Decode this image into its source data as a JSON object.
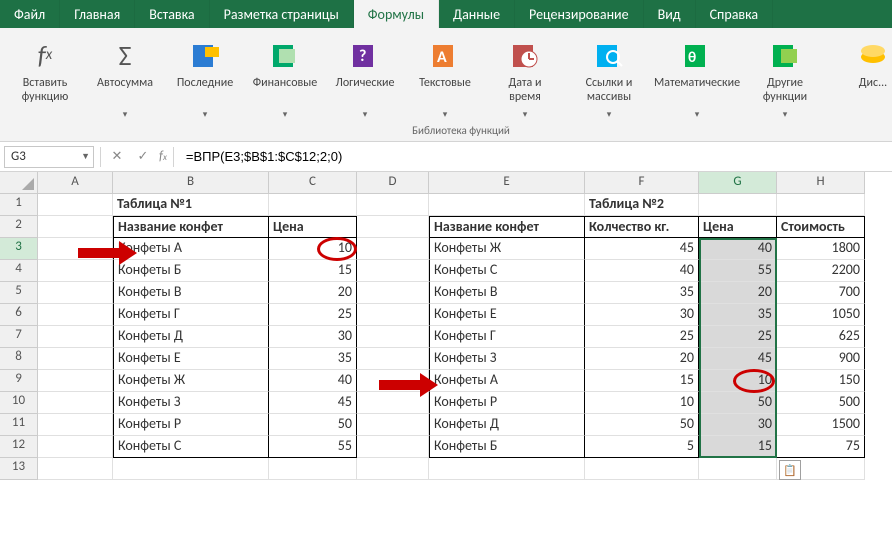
{
  "tabs": [
    "Файл",
    "Главная",
    "Вставка",
    "Разметка страницы",
    "Формулы",
    "Данные",
    "Рецензирование",
    "Вид",
    "Справка"
  ],
  "active_tab": "Формулы",
  "ribbon": {
    "group_label": "Библиотека функций",
    "items": [
      {
        "label": "Вставить\nфункцию",
        "icon": "fx",
        "key": "insert-function"
      },
      {
        "label": "Автосумма",
        "icon": "sigma",
        "key": "autosum",
        "arrow": true
      },
      {
        "label": "Последние",
        "icon": "recent",
        "key": "recent",
        "arrow": true
      },
      {
        "label": "Финансовые",
        "icon": "financial",
        "key": "financial",
        "arrow": true
      },
      {
        "label": "Логические",
        "icon": "logical",
        "key": "logical",
        "arrow": true
      },
      {
        "label": "Текстовые",
        "icon": "text",
        "key": "text",
        "arrow": true
      },
      {
        "label": "Дата и\nвремя",
        "icon": "date",
        "key": "date-time",
        "arrow": true
      },
      {
        "label": "Ссылки и\nмассивы",
        "icon": "lookup",
        "key": "lookup",
        "arrow": true
      },
      {
        "label": "Математические",
        "icon": "math",
        "key": "math",
        "arrow": true
      },
      {
        "label": "Другие\nфункции",
        "icon": "more",
        "key": "more",
        "arrow": true
      },
      {
        "label": "Дис...",
        "icon": "dispatch",
        "key": "dispatch-partial"
      }
    ]
  },
  "name_box": "G3",
  "formula": "=ВПР(E3;$B$1:$C$12;2;0)",
  "columns": [
    "A",
    "B",
    "C",
    "D",
    "E",
    "F",
    "G",
    "H"
  ],
  "rows": [
    1,
    2,
    3,
    4,
    5,
    6,
    7,
    8,
    9,
    10,
    11,
    12,
    13
  ],
  "selected_column": "G",
  "selected_row": 3,
  "table1": {
    "title": "Таблица №1",
    "headers": [
      "Название конфет",
      "Цена"
    ],
    "rows": [
      [
        "Конфеты А",
        10
      ],
      [
        "Конфеты Б",
        15
      ],
      [
        "Конфеты В",
        20
      ],
      [
        "Конфеты Г",
        25
      ],
      [
        "Конфеты Д",
        30
      ],
      [
        "Конфеты Е",
        35
      ],
      [
        "Конфеты Ж",
        40
      ],
      [
        "Конфеты З",
        45
      ],
      [
        "Конфеты Р",
        50
      ],
      [
        "Конфеты С",
        55
      ]
    ]
  },
  "table2": {
    "title": "Таблица №2",
    "headers": [
      "Название конфет",
      "Колчество кг.",
      "Цена",
      "Стоимость"
    ],
    "rows": [
      [
        "Конфеты Ж",
        45,
        40,
        1800
      ],
      [
        "Конфеты С",
        40,
        55,
        2200
      ],
      [
        "Конфеты В",
        35,
        20,
        700
      ],
      [
        "Конфеты Е",
        30,
        35,
        1050
      ],
      [
        "Конфеты Г",
        25,
        25,
        625
      ],
      [
        "Конфеты З",
        20,
        45,
        900
      ],
      [
        "Конфеты А",
        15,
        10,
        150
      ],
      [
        "Конфеты Р",
        10,
        50,
        500
      ],
      [
        "Конфеты Д",
        50,
        30,
        1500
      ],
      [
        "Конфеты Б",
        5,
        15,
        75
      ]
    ]
  },
  "paste_options_label": "⎘"
}
